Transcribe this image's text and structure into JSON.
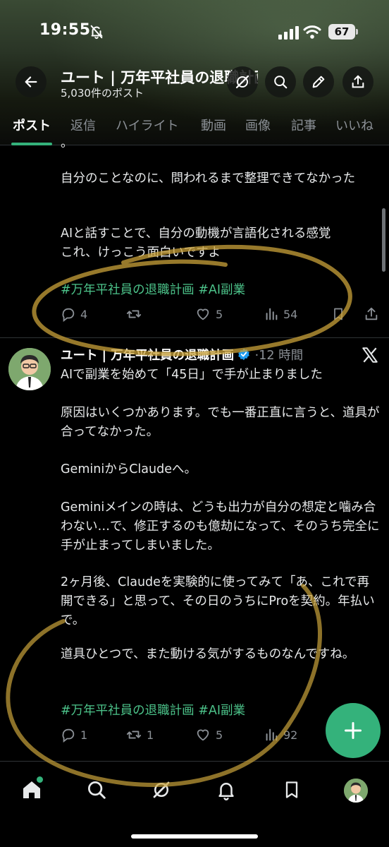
{
  "status_bar": {
    "time": "19:55",
    "battery": "67",
    "icons": [
      "bell-off-icon",
      "signal-icon",
      "wifi-icon",
      "battery-icon"
    ]
  },
  "header": {
    "title": "ユート | 万年平社員の退職計画",
    "subtitle": "5,030件のポスト",
    "buttons": [
      "back-arrow-icon",
      "grok-icon",
      "search-icon",
      "pencil-icon",
      "share-icon"
    ]
  },
  "tabs": [
    {
      "label": "ポスト",
      "active": true
    },
    {
      "label": "返信"
    },
    {
      "label": "ハイライト"
    },
    {
      "label": "動画"
    },
    {
      "label": "画像"
    },
    {
      "label": "記事"
    },
    {
      "label": "いいね"
    }
  ],
  "post1": {
    "partial_top": "。",
    "paragraphs": [
      "自分のことなのに、問われるまで整理できてなかった",
      "AIと話すことで、自分の動機が言語化される感覚\nこれ、けっこう面白いですよ"
    ],
    "hashtags": "#万年平社員の退職計画 #AI副業",
    "replies": "4",
    "reposts": "",
    "likes": "5",
    "views": "54"
  },
  "post2": {
    "author": "ユート | 万年平社員の退職計画",
    "time": "12 時間",
    "separator": "·",
    "paragraphs": [
      "AIで副業を始めて「45日」で手が止まりました",
      "原因はいくつかあります。でも一番正直に言うと、道具が合ってなかった。",
      "GeminiからClaudeへ。",
      "Geminiメインの時は、どうも出力が自分の想定と噛み合わない…で、修正するのも億劫になって、そのうち完全に手が止まってしまいました。",
      "2ヶ月後、Claudeを実験的に使ってみて「あ、これで再開できる」と思って、その日のうちにProを契約。年払いで。",
      "道具ひとつで、また動ける気がするものなんですね。"
    ],
    "hashtags": "#万年平社員の退職計画 #AI副業",
    "replies": "1",
    "reposts": "1",
    "likes": "5",
    "views": "92"
  },
  "fab": {
    "icon": "plus-icon"
  },
  "bottom_nav": [
    "home-icon",
    "search-icon",
    "grok-icon",
    "notifications-icon",
    "bookmark-icon",
    "profile-avatar"
  ],
  "colors": {
    "accent": "#34b27b",
    "hashtag": "#4cc38a",
    "verified": "#1d9bf0",
    "scribble": "#c9a23a"
  }
}
